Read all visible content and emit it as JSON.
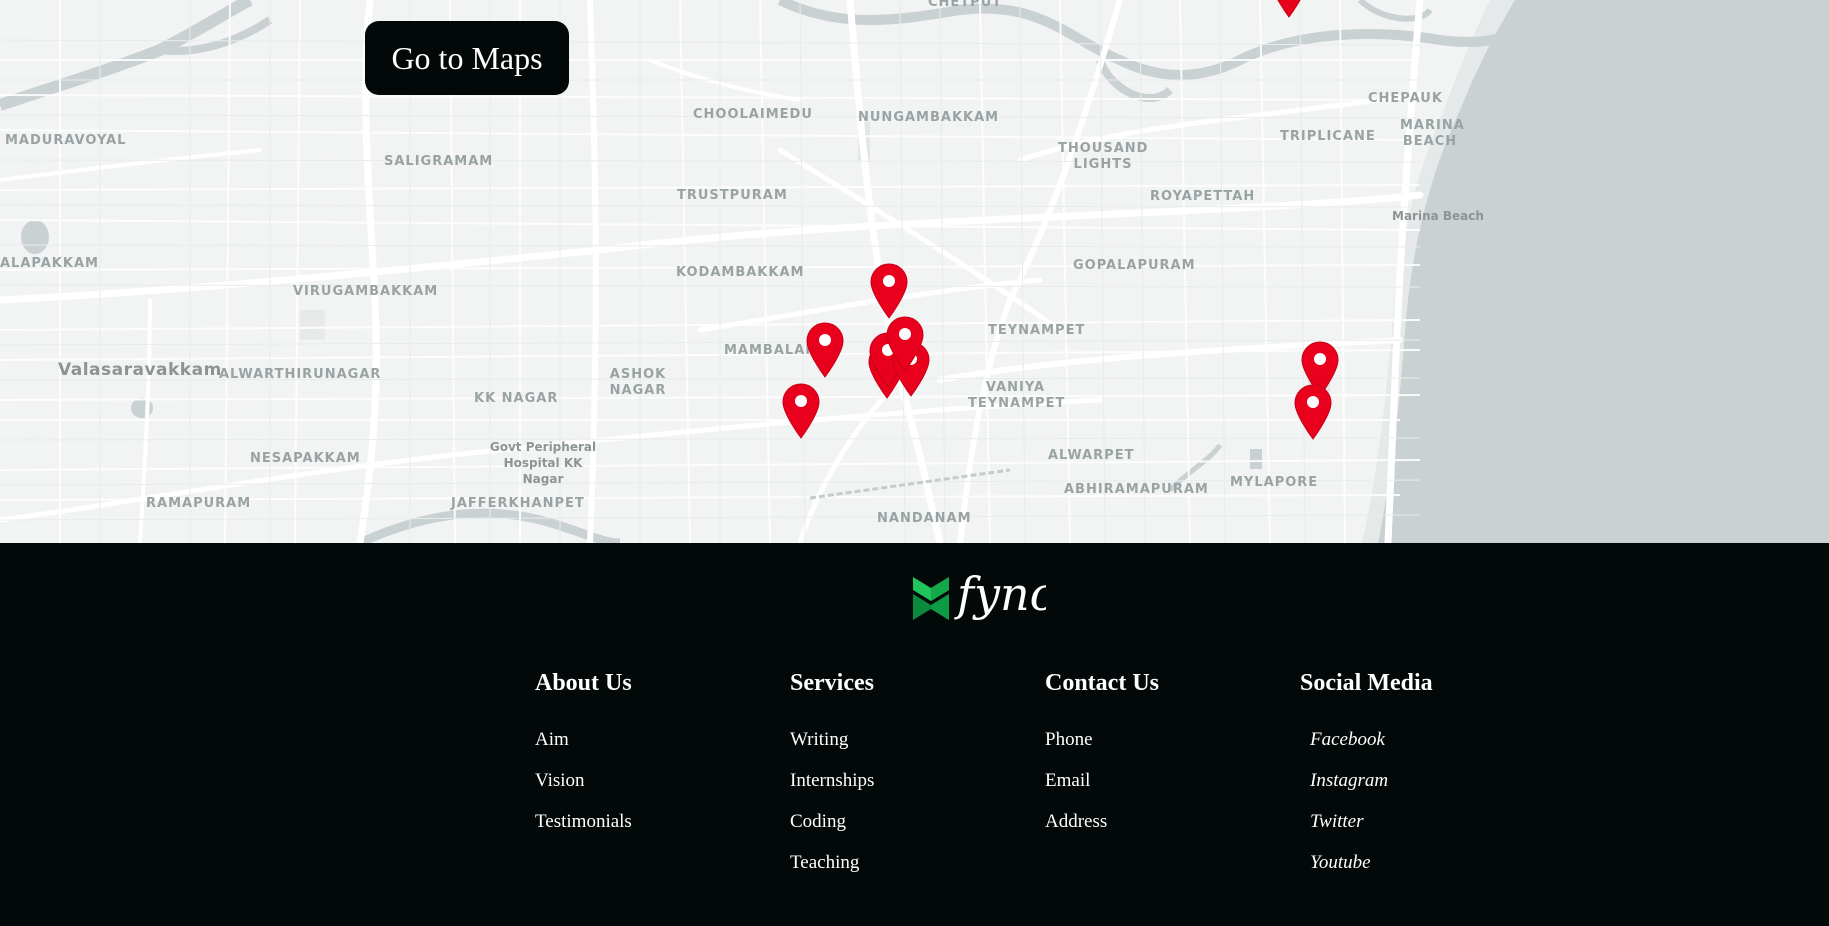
{
  "map": {
    "button_label": "Go to Maps",
    "colors": {
      "land": "#f2f3f3",
      "road": "#ffffff",
      "water": "#c9d1d2",
      "marker": "#e8001c"
    },
    "labels": [
      "CHETPUT",
      "CHOOLAIMEDU",
      "NUNGAMBAKKAM",
      "MADURAVOYAL",
      "SALIGRAMAM",
      "THOUSAND LIGHTS",
      "CHEPAUK",
      "MARINA BEACH",
      "TRIPLICANE",
      "TRUSTPURAM",
      "ROYAPETTAH",
      "Marina Beach",
      "ALAPAKKAM",
      "VIRUGAMBAKKAM",
      "KODAMBAKKAM",
      "GOPALAPURAM",
      "TEYNAMPET",
      "MAMBALAM",
      "Valasaravakkam",
      "ALWARTHIRUNAGAR",
      "ASHOK NAGAR",
      "KK NAGAR",
      "VANIYA TEYNAMPET",
      "NESAPAKKAM",
      "Govt Peripheral Hospital KK Nagar",
      "ALWARPET",
      "ABHIRAMAPURAM",
      "MYLAPORE",
      "RAMAPURAM",
      "JAFFERKHANPET",
      "NANDANAM"
    ],
    "marker_icon": "map-pin-icon",
    "marker_count": 10
  },
  "footer": {
    "logo_text": "fync",
    "logo_colors": {
      "green_dark": "#0a8a3c",
      "green_light": "#1fc45a"
    },
    "columns": [
      {
        "title": "About Us",
        "items": [
          "Aim",
          "Vision",
          "Testimonials"
        ]
      },
      {
        "title": "Services",
        "items": [
          "Writing",
          "Internships",
          "Coding",
          "Teaching"
        ]
      },
      {
        "title": "Contact Us",
        "items": [
          "Phone",
          "Email",
          "Address"
        ]
      },
      {
        "title": "Social Media",
        "items": [
          "Facebook",
          "Instagram",
          "Twitter",
          "Youtube"
        ]
      }
    ]
  }
}
